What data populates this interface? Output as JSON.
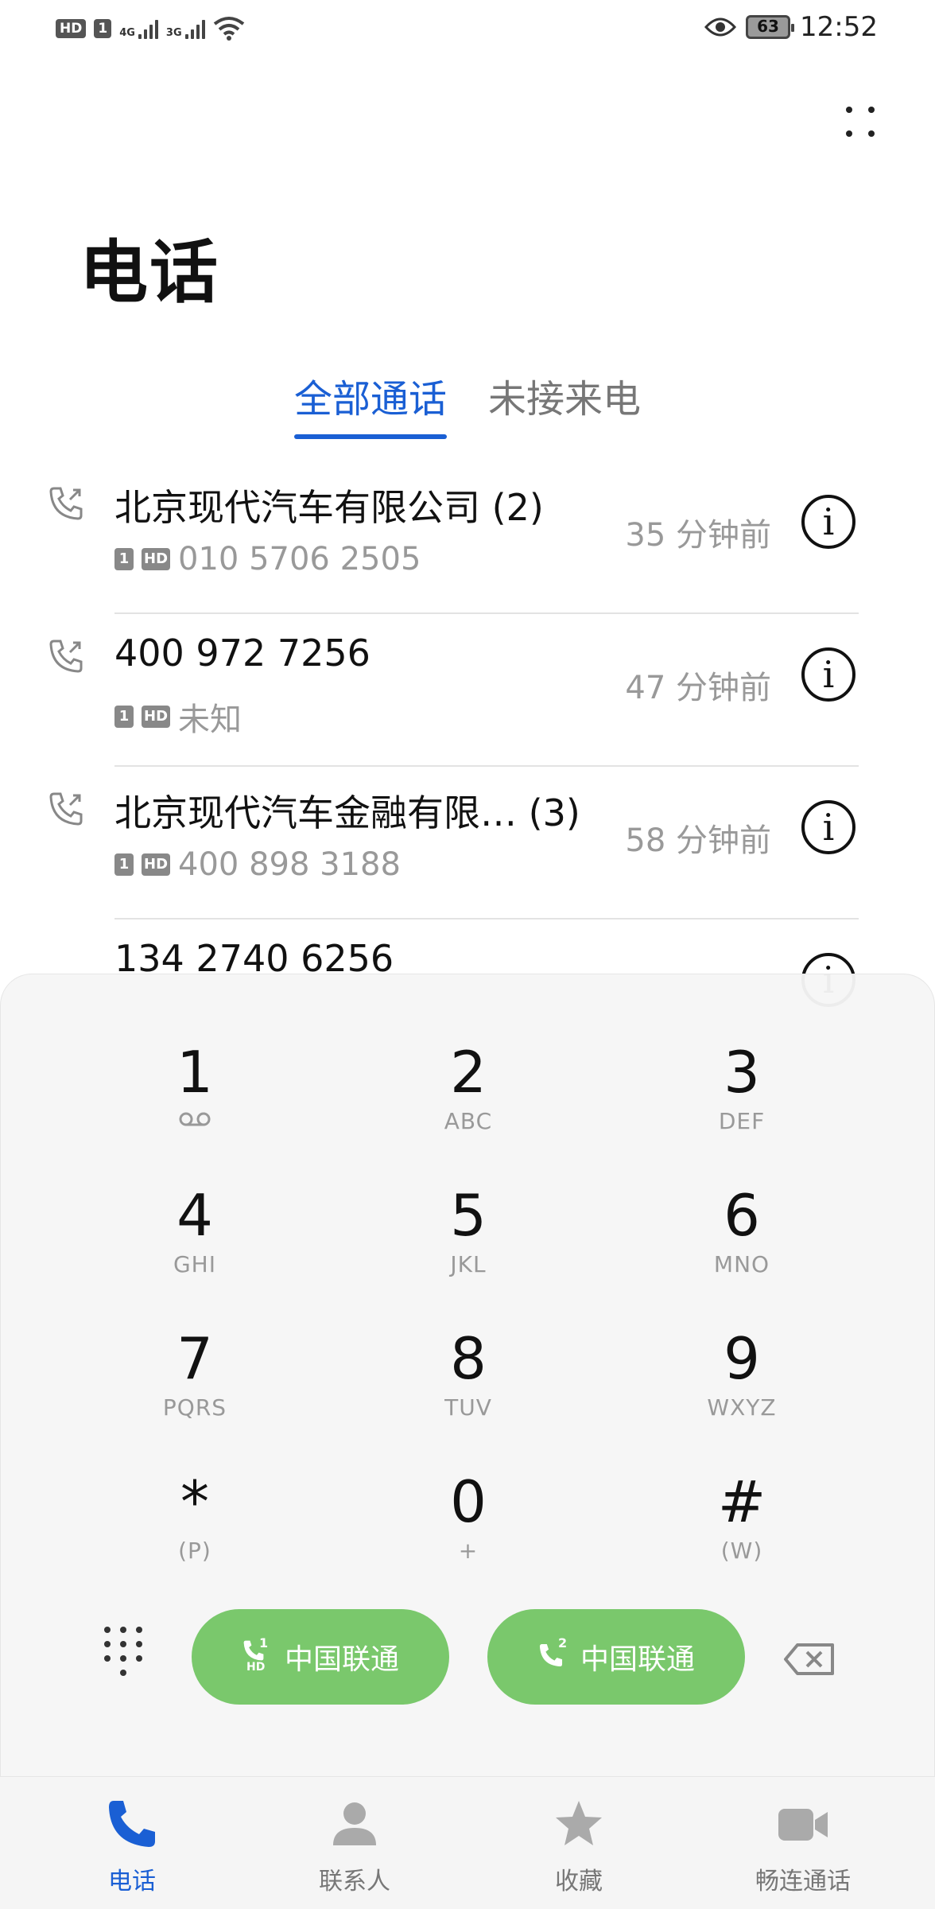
{
  "status_bar": {
    "badges": [
      "HD",
      "1"
    ],
    "network": [
      "4G",
      "3G"
    ],
    "battery": "63",
    "time": "12:52"
  },
  "page_title": "电话",
  "tabs": [
    {
      "label": "全部通话",
      "active": true
    },
    {
      "label": "未接来电",
      "active": false
    }
  ],
  "calls": [
    {
      "name": "北京现代汽车有限公司 (2)",
      "sim": "1",
      "hd": "HD",
      "number": "010 5706 2505",
      "time": "35 分钟前"
    },
    {
      "name": "400 972 7256",
      "sim": "1",
      "hd": "HD",
      "number": "未知",
      "time": "47 分钟前"
    },
    {
      "name": "北京现代汽车金融有限…  (3)",
      "sim": "1",
      "hd": "HD",
      "number": "400 898 3188",
      "time": "58 分钟前"
    },
    {
      "name": "134 2740 6256",
      "sim": "",
      "hd": "",
      "number": "",
      "time": ""
    }
  ],
  "dialpad": {
    "keys": [
      {
        "num": "1",
        "sub": ""
      },
      {
        "num": "2",
        "sub": "ABC"
      },
      {
        "num": "3",
        "sub": "DEF"
      },
      {
        "num": "4",
        "sub": "GHI"
      },
      {
        "num": "5",
        "sub": "JKL"
      },
      {
        "num": "6",
        "sub": "MNO"
      },
      {
        "num": "7",
        "sub": "PQRS"
      },
      {
        "num": "8",
        "sub": "TUV"
      },
      {
        "num": "9",
        "sub": "WXYZ"
      },
      {
        "num": "*",
        "sub": "(P)"
      },
      {
        "num": "0",
        "sub": "+"
      },
      {
        "num": "#",
        "sub": "(W)"
      }
    ],
    "call_buttons": [
      {
        "label": "中国联通",
        "sim": "1",
        "extra": "HD"
      },
      {
        "label": "中国联通",
        "sim": "2",
        "extra": ""
      }
    ]
  },
  "bottom_nav": [
    {
      "label": "电话",
      "icon": "phone-icon",
      "active": true
    },
    {
      "label": "联系人",
      "icon": "contacts-icon",
      "active": false
    },
    {
      "label": "收藏",
      "icon": "star-icon",
      "active": false
    },
    {
      "label": "畅连通话",
      "icon": "video-call-icon",
      "active": false
    }
  ],
  "colors": {
    "accent": "#1a5fd4",
    "call_green": "#7ac86c"
  }
}
